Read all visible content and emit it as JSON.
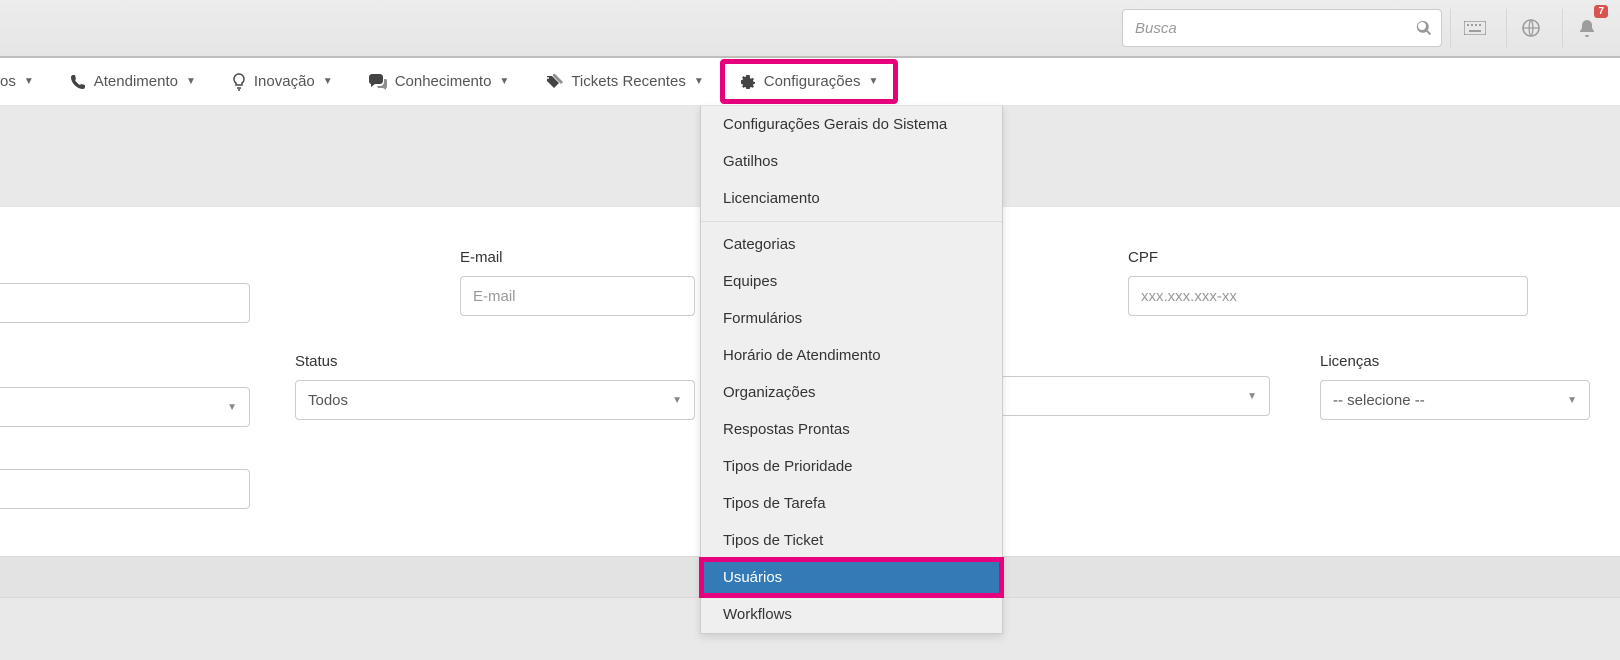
{
  "topbar": {
    "search_placeholder": "Busca",
    "notifications": "7"
  },
  "nav": {
    "items": [
      {
        "label": "os"
      },
      {
        "label": "Atendimento"
      },
      {
        "label": "Inovação"
      },
      {
        "label": "Conhecimento"
      },
      {
        "label": "Tickets Recentes"
      },
      {
        "label": "Configurações"
      }
    ]
  },
  "dropdown": {
    "group1": [
      "Configurações Gerais do Sistema",
      "Gatilhos",
      "Licenciamento"
    ],
    "group2": [
      "Categorias",
      "Equipes",
      "Formulários",
      "Horário de Atendimento",
      "Organizações",
      "Respostas Prontas",
      "Tipos de Prioridade",
      "Tipos de Tarefa",
      "Tipos de Ticket",
      "Usuários",
      "Workflows"
    ],
    "active": "Usuários"
  },
  "form": {
    "email": {
      "label": "E-mail",
      "placeholder": "E-mail"
    },
    "cpf": {
      "label": "CPF",
      "placeholder": "xxx.xxx.xxx-xx"
    },
    "status": {
      "label": "Status",
      "value": "Todos"
    },
    "licencas": {
      "label": "Licenças",
      "value": "-- selecione --"
    }
  }
}
